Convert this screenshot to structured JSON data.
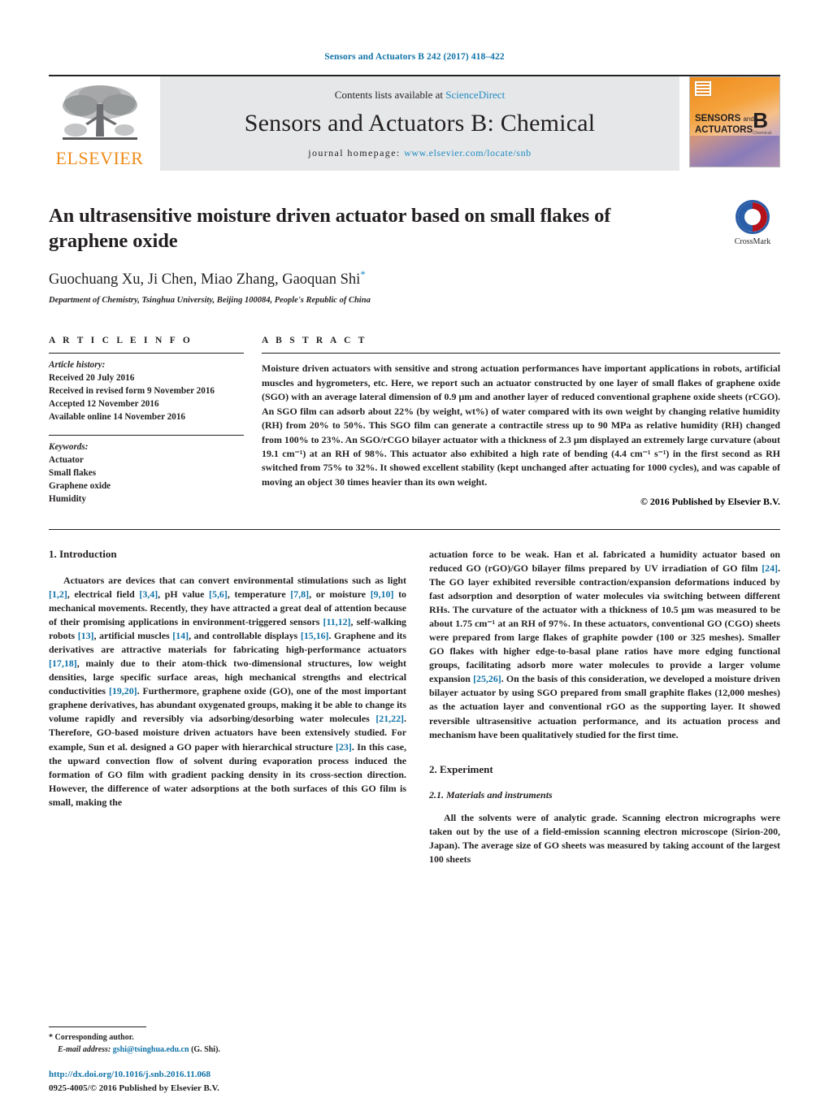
{
  "running_head": "Sensors and Actuators B 242 (2017) 418–422",
  "masthead": {
    "publisher": "ELSEVIER",
    "contents_prefix": "Contents lists available at ",
    "contents_link": "ScienceDirect",
    "journal_title": "Sensors and Actuators B: Chemical",
    "homepage_label": "journal homepage:",
    "homepage_url": "www.elsevier.com/locate/snb",
    "cover": {
      "line1": "SENSORS",
      "line1_small": "and",
      "line2": "ACTUATORS",
      "letter": "B",
      "sub": "Chemical"
    }
  },
  "article": {
    "title": "An ultrasensitive moisture driven actuator based on small flakes of graphene oxide",
    "authors": "Guochuang Xu, Ji Chen, Miao Zhang, Gaoquan Shi",
    "corresponding_marker": "*",
    "affiliation": "Department of Chemistry, Tsinghua University, Beijing 100084, People's Republic of China",
    "crossmark_label": "CrossMark"
  },
  "info": {
    "heading": "A R T I C L E     I N F O",
    "history_label": "Article history:",
    "history": [
      "Received 20 July 2016",
      "Received in revised form 9 November 2016",
      "Accepted 12 November 2016",
      "Available online 14 November 2016"
    ],
    "keywords_label": "Keywords:",
    "keywords": [
      "Actuator",
      "Small flakes",
      "Graphene oxide",
      "Humidity"
    ]
  },
  "abstract": {
    "heading": "A B S T R A C T",
    "text": "Moisture driven actuators with sensitive and strong actuation performances have important applications in robots, artificial muscles and hygrometers, etc. Here, we report such an actuator constructed by one layer of small flakes of graphene oxide (SGO) with an average lateral dimension of 0.9 μm and another layer of reduced conventional graphene oxide sheets (rCGO). An SGO film can adsorb about 22% (by weight, wt%) of water compared with its own weight by changing relative humidity (RH) from 20% to 50%. This SGO film can generate a contractile stress up to 90 MPa as relative humidity (RH) changed from 100% to 23%. An SGO/rCGO bilayer actuator with a thickness of 2.3 μm displayed an extremely large curvature (about 19.1 cm⁻¹) at an RH of 98%. This actuator also exhibited a high rate of bending (4.4 cm⁻¹ s⁻¹) in the first second as RH switched from 75% to 32%. It showed excellent stability (kept unchanged after actuating for 1000 cycles), and was capable of moving an object 30 times heavier than its own weight.",
    "copyright": "© 2016 Published by Elsevier B.V."
  },
  "body": {
    "intro_heading": "1.  Introduction",
    "intro_p1_a": "Actuators are devices that can convert environmental stimulations such as light ",
    "intro_refs": {
      "r1": "[1,2]",
      "r2": "[3,4]",
      "r3": "[5,6]",
      "r4": "[7,8]",
      "r5": "[9,10]",
      "r6": "[11,12]",
      "r7": "[13]",
      "r8": "[14]",
      "r9": "[15,16]",
      "r10": "[17,18]",
      "r11": "[19,20]",
      "r12": "[21,22]",
      "r13": "[23]",
      "r14": "[24]",
      "r15": "[25,26]"
    },
    "intro_p1_b": ", electrical field ",
    "intro_p1_c": ", pH value ",
    "intro_p1_d": ", temperature ",
    "intro_p1_e": ", or moisture ",
    "intro_p1_f": " to mechanical movements. Recently, they have attracted a great deal of attention because of their promising applications in environment-triggered sensors ",
    "intro_p1_g": ", self-walking robots ",
    "intro_p1_h": ", artificial muscles ",
    "intro_p1_i": ", and controllable displays ",
    "intro_p1_j": ". Graphene and its derivatives are attractive materials for fabricating high-performance actuators ",
    "intro_p1_k": ", mainly due to their atom-thick two-dimensional structures, low weight densities, large specific surface areas, high mechanical strengths and electrical conductivities ",
    "intro_p1_l": ". Furthermore, graphene oxide (GO), one of the most important graphene derivatives, has abundant oxygenated groups, making it be able to change its volume rapidly and reversibly via adsorbing/desorbing water molecules ",
    "intro_p1_m": ". Therefore, GO-based moisture driven actuators have been extensively studied. For example, Sun et al. designed a GO paper with hierarchical structure ",
    "intro_p1_n": ". In this case, the upward convection flow of solvent during evaporation process induced the formation of GO film with gradient packing density in its cross-section direction. However, the difference of water adsorptions at the both surfaces of this GO film is small, making the",
    "right_p1_a": "actuation force to be weak. Han et al. fabricated a humidity actuator based on reduced GO (rGO)/GO bilayer films prepared by UV irradiation of GO film ",
    "right_p1_b": ". The GO layer exhibited reversible contraction/expansion deformations induced by fast adsorption and desorption of water molecules via switching between different RHs. The curvature of the actuator with a thickness of 10.5 μm was measured to be about 1.75 cm⁻¹ at an RH of 97%. In these actuators, conventional GO (CGO) sheets were prepared from large flakes of graphite powder (100 or 325 meshes). Smaller GO flakes with higher edge-to-basal plane ratios have more edging functional groups, facilitating adsorb more water molecules to provide a larger volume expansion ",
    "right_p1_c": ". On the basis of this consideration, we developed a moisture driven bilayer actuator by using SGO prepared from small graphite flakes (12,000 meshes) as the actuation layer and conventional rGO as the supporting layer. It showed reversible ultrasensitive actuation performance, and its actuation process and mechanism have been qualitatively studied for the first time.",
    "exp_heading": "2.  Experiment",
    "exp_sub_heading": "2.1.  Materials and instruments",
    "exp_p1": "All the solvents were of analytic grade. Scanning electron micrographs were taken out by the use of a field-emission scanning electron microscope (Sirion-200, Japan). The average size of GO sheets was measured by taking account of the largest 100 sheets"
  },
  "footer": {
    "corresponding": "*  Corresponding author.",
    "email_label": "E-mail address:",
    "email": "gshi@tsinghua.edu.cn",
    "email_suffix": " (G. Shi).",
    "doi": "http://dx.doi.org/10.1016/j.snb.2016.11.068",
    "issn": "0925-4005/© 2016 Published by Elsevier B.V."
  },
  "colors": {
    "link": "#1073a8",
    "elsevier_orange": "#f08c1b",
    "band_gray": "#e6e7e8"
  }
}
